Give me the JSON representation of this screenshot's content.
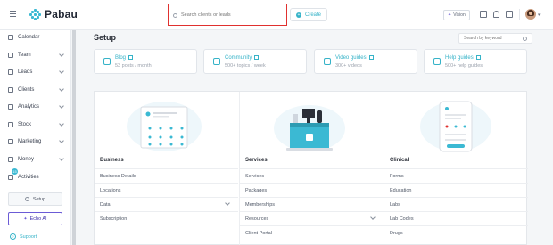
{
  "app": {
    "name": "Pabau",
    "brand_color": "#3bb9d3"
  },
  "topbar": {
    "search_placeholder": "Search clients or leads",
    "create_label": "Create",
    "vision_label": "Vision",
    "icons": [
      "calendar-icon",
      "bell-icon",
      "clipboard-icon"
    ]
  },
  "sidebar": {
    "items": [
      {
        "label": "Calendar",
        "icon": "calendar-icon",
        "has_chevron": false
      },
      {
        "label": "Team",
        "icon": "team-icon",
        "has_chevron": true
      },
      {
        "label": "Leads",
        "icon": "leads-icon",
        "has_chevron": true
      },
      {
        "label": "Clients",
        "icon": "clients-icon",
        "has_chevron": true
      },
      {
        "label": "Analytics",
        "icon": "analytics-icon",
        "has_chevron": true
      },
      {
        "label": "Stock",
        "icon": "stock-icon",
        "has_chevron": true
      },
      {
        "label": "Marketing",
        "icon": "marketing-icon",
        "has_chevron": true
      },
      {
        "label": "Money",
        "icon": "money-icon",
        "has_chevron": true
      },
      {
        "label": "Activities",
        "icon": "activities-icon",
        "has_chevron": false,
        "badge": "15"
      }
    ],
    "setup_label": "Setup",
    "echo_label": "Echo AI",
    "support_label": "Support"
  },
  "main": {
    "title": "Setup",
    "keyword_placeholder": "Search by keyword",
    "resources": [
      {
        "title": "Blog",
        "subtitle": "53 posts / month",
        "icon": "pencil-icon"
      },
      {
        "title": "Community",
        "subtitle": "500+ topics / week",
        "icon": "community-icon"
      },
      {
        "title": "Video guides",
        "subtitle": "300+ videos",
        "icon": "video-icon"
      },
      {
        "title": "Help guides",
        "subtitle": "500+ help guides",
        "icon": "help-icon"
      }
    ],
    "sections": [
      {
        "title": "Business",
        "rows": [
          {
            "label": "Business Details",
            "expandable": false
          },
          {
            "label": "Locations",
            "expandable": false
          },
          {
            "label": "Data",
            "expandable": true
          },
          {
            "label": "Subscription",
            "expandable": false
          }
        ]
      },
      {
        "title": "Services",
        "rows": [
          {
            "label": "Services",
            "expandable": false
          },
          {
            "label": "Packages",
            "expandable": false
          },
          {
            "label": "Memberships",
            "expandable": false
          },
          {
            "label": "Resources",
            "expandable": true
          },
          {
            "label": "Client Portal",
            "expandable": false
          }
        ]
      },
      {
        "title": "Clinical",
        "rows": [
          {
            "label": "Forms",
            "expandable": false
          },
          {
            "label": "Education",
            "expandable": false
          },
          {
            "label": "Labs",
            "expandable": false
          },
          {
            "label": "Lab Codes",
            "expandable": false
          },
          {
            "label": "Drugs",
            "expandable": false
          }
        ]
      }
    ]
  }
}
